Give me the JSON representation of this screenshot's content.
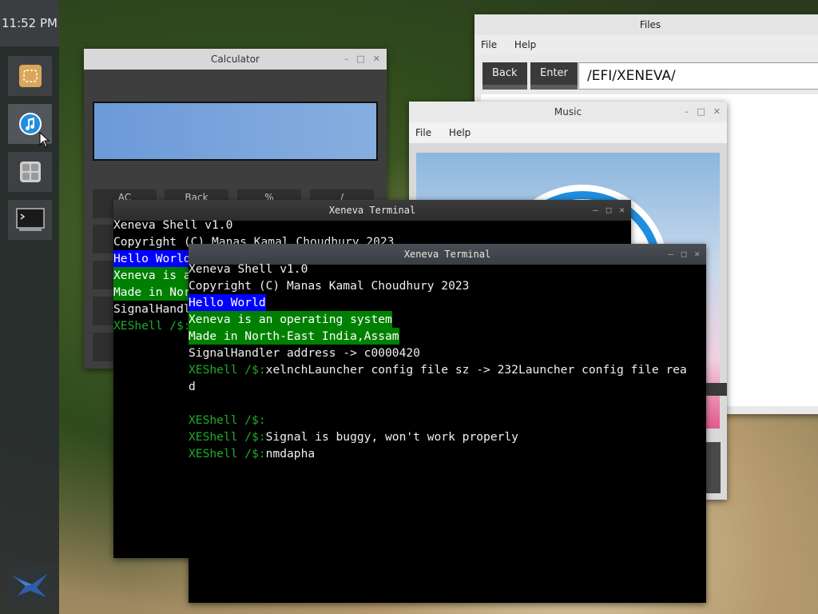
{
  "dock": {
    "clock": "11:52 PM",
    "items": [
      {
        "name": "files-app",
        "icon": "folder-icon"
      },
      {
        "name": "music-app",
        "icon": "music-note-icon"
      },
      {
        "name": "calculator-app",
        "icon": "calculator-icon"
      },
      {
        "name": "terminal-app",
        "icon": "terminal-icon"
      }
    ],
    "logo_icon": "xeneva-logo-icon"
  },
  "files_window": {
    "title": "Files",
    "menu": [
      "File",
      "Help"
    ],
    "back_label": "Back",
    "enter_label": "Enter",
    "path_value": "/EFI/XENEVA/"
  },
  "music_window": {
    "title": "Music",
    "menu": [
      "File",
      "Help"
    ]
  },
  "calculator_window": {
    "title": "Calculator",
    "keys": [
      "AC",
      "Back",
      "%",
      "/"
    ]
  },
  "terminal_back": {
    "title": "Xeneva Terminal",
    "lines": [
      "Xeneva Shell v1.0",
      "Copyright (C) Manas Kamal Choudhury 2023",
      "Hello World",
      "Xeneva is an operating system",
      "Made in North-East India,Assam",
      "SignalHandler address -> c0000420",
      "XEShell /$:"
    ]
  },
  "terminal_front": {
    "title": "Xeneva Terminal",
    "line1": "Xeneva Shell v1.0",
    "line2": "Copyright (C) Manas Kamal Choudhury 2023",
    "line3": "Hello World",
    "line4": "Xeneva is an operating system",
    "line5": "Made in North-East India,Assam",
    "line6": "SignalHandler address -> c0000420",
    "prompt": "XEShell /$:",
    "cmd1": "xelnchLauncher config file sz -> 232Launcher config file rea",
    "cmd1_wrap": "d",
    "cmd3": "Signal is buggy, won't work properly",
    "cmd4": "nmdapha"
  },
  "colors": {
    "prompt_green": "#1dad2a",
    "highlight_blue": "#0000ff",
    "highlight_green": "#008000"
  }
}
